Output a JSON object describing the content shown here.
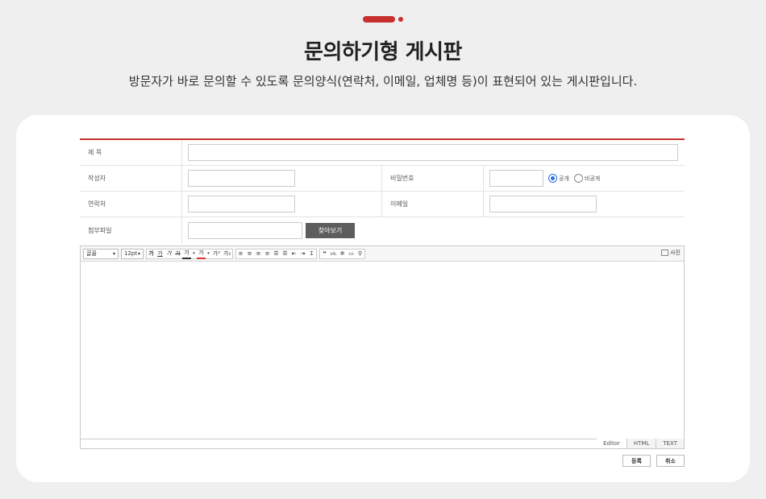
{
  "header": {
    "title": "문의하기형 게시판",
    "subtitle": "방문자가 바로 문의할 수 있도록 문의양식(연락처, 이메일, 업체명 등)이 표현되어 있는 게시판입니다.",
    "accent_color": "#c8302e"
  },
  "form": {
    "subject_label": "제 목",
    "subject_value": "",
    "author_label": "작성자",
    "author_value": "",
    "password_label": "비밀번호",
    "password_value": "",
    "visibility": {
      "public_label": "공개",
      "private_label": "비공개",
      "selected": "public"
    },
    "contact_label": "연락처",
    "contact_value": "",
    "email_label": "이메일",
    "email_value": "",
    "attachment_label": "첨부파일",
    "attachment_value": "",
    "browse_label": "찾아보기"
  },
  "editor": {
    "font_select": "글꼴",
    "size_select": "12pt",
    "format_buttons": [
      {
        "label": "가",
        "icon": "bold-icon"
      },
      {
        "label": "가",
        "icon": "underline-icon"
      },
      {
        "label": "가",
        "icon": "italic-icon"
      },
      {
        "label": "가",
        "icon": "strikethrough-icon"
      },
      {
        "label": "가",
        "icon": "font-color-icon"
      },
      {
        "label": "가",
        "icon": "highlight-icon"
      },
      {
        "label": "가²",
        "icon": "superscript-icon"
      },
      {
        "label": "가₂",
        "icon": "subscript-icon"
      }
    ],
    "photo_label": "사진",
    "tabs": [
      "Editor",
      "HTML",
      "TEXT"
    ],
    "active_tab": "Editor"
  },
  "actions": {
    "submit_label": "등록",
    "cancel_label": "취소"
  }
}
